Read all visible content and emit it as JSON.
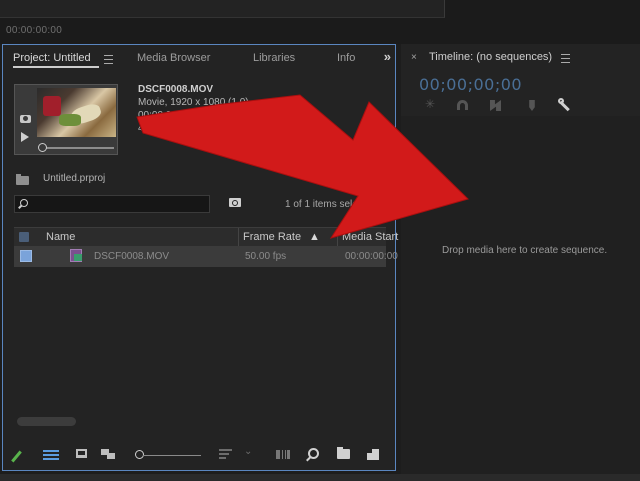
{
  "header": {
    "timecode": "00:00:00:00"
  },
  "project": {
    "tabs": [
      {
        "label": "Project: Untitled"
      },
      {
        "label": "Media Browser"
      },
      {
        "label": "Libraries"
      },
      {
        "label": "Info"
      }
    ],
    "overflow": "»",
    "preview": {
      "clip_name": "DSCF0008.MOV",
      "line1": "Movie, 1920 x 1080 (1.0)",
      "line2": "00:00:09:00, 50.00p",
      "line3": "48000 Hz - 16-bit - Stereo"
    },
    "file_name": "Untitled.prproj",
    "search": {
      "placeholder": "",
      "value": ""
    },
    "items_count": "1 of 1 items selected",
    "columns": [
      "Name",
      "Frame Rate",
      "Media Start"
    ],
    "sort_indicator": "▲",
    "rows": [
      {
        "name": "DSCF0008.MOV",
        "frame_rate": "50.00 fps",
        "media_start": "00:00:00:00",
        "selected": true
      }
    ]
  },
  "timeline": {
    "close": "×",
    "title": "Timeline: (no sequences)",
    "timecode": "00;00;00;00",
    "drop_hint": "Drop media here to create sequence."
  },
  "icons": [
    "camera-icon",
    "play-icon",
    "folder-icon",
    "search-icon",
    "bin-search-icon",
    "sequence-clip-icon",
    "pencil-icon",
    "list-view-icon",
    "icon-view-icon",
    "freeform-view-icon",
    "zoom-slider",
    "sort-icons",
    "automate-to-sequence-icon",
    "find-icon",
    "new-bin-icon",
    "new-item-icon",
    "snap-icon",
    "linked-selection-icon",
    "add-marker-icon",
    "timeline-settings-wrench-icon",
    "insert-icon",
    "hamburger-menu-icon"
  ],
  "colors": {
    "panel_focus_border": "#5a86c0",
    "timecode_blue": "#4a6f96",
    "selected_row": "#3b3b3b",
    "annotation_arrow": "#d21a1a"
  }
}
